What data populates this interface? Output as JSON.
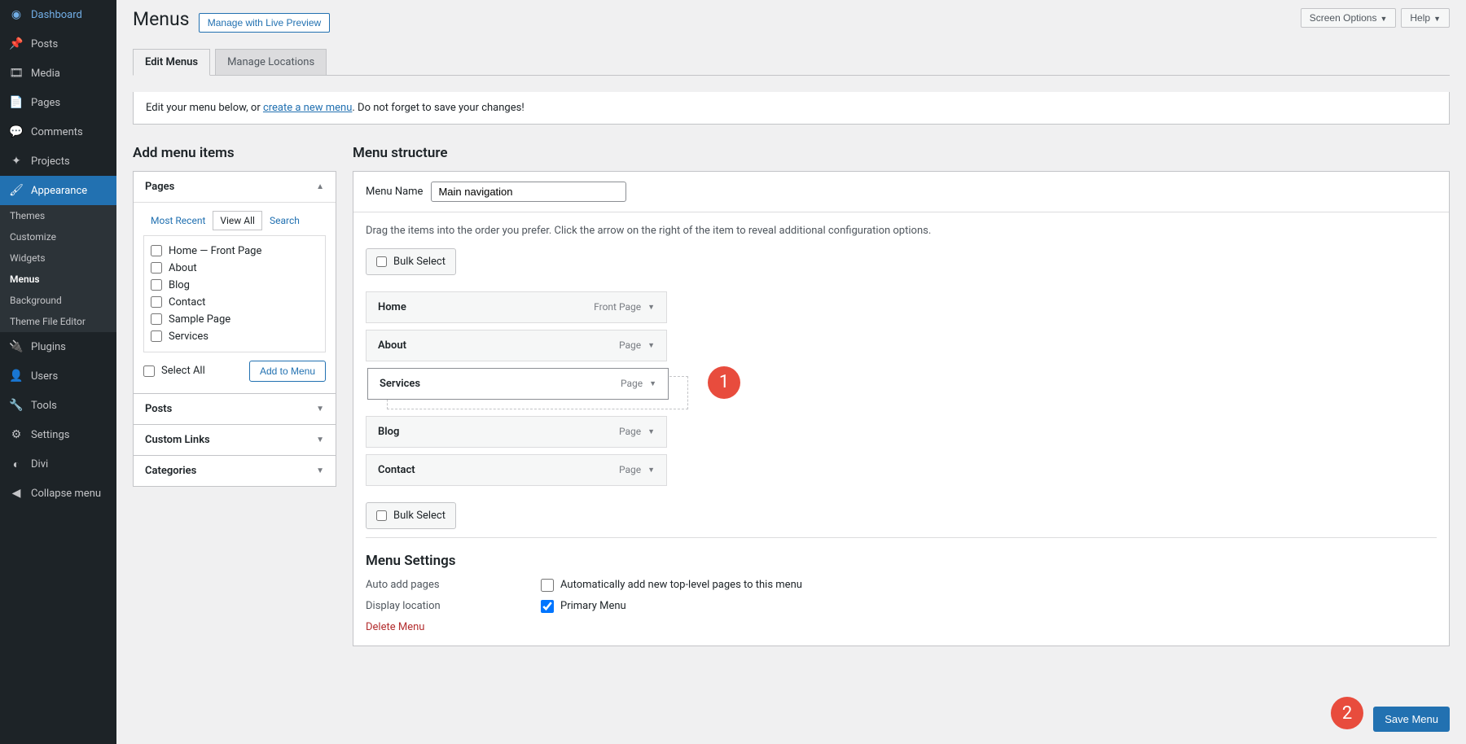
{
  "topbar": {
    "screen_options": "Screen Options",
    "help": "Help"
  },
  "sidebar": {
    "items": [
      {
        "label": "Dashboard"
      },
      {
        "label": "Posts"
      },
      {
        "label": "Media"
      },
      {
        "label": "Pages"
      },
      {
        "label": "Comments"
      },
      {
        "label": "Projects"
      },
      {
        "label": "Appearance"
      },
      {
        "label": "Plugins"
      },
      {
        "label": "Users"
      },
      {
        "label": "Tools"
      },
      {
        "label": "Settings"
      },
      {
        "label": "Divi"
      },
      {
        "label": "Collapse menu"
      }
    ],
    "sub": [
      {
        "label": "Themes"
      },
      {
        "label": "Customize"
      },
      {
        "label": "Widgets"
      },
      {
        "label": "Menus"
      },
      {
        "label": "Background"
      },
      {
        "label": "Theme File Editor"
      }
    ]
  },
  "page": {
    "title": "Menus",
    "live_preview": "Manage with Live Preview",
    "tabs": {
      "edit": "Edit Menus",
      "locations": "Manage Locations"
    },
    "notice_pre": "Edit your menu below, or ",
    "notice_link": "create a new menu",
    "notice_post": ". Do not forget to save your changes!"
  },
  "add": {
    "title": "Add menu items",
    "pages_head": "Pages",
    "subtabs": {
      "recent": "Most Recent",
      "all": "View All",
      "search": "Search"
    },
    "list": [
      "Home — Front Page",
      "About",
      "Blog",
      "Contact",
      "Sample Page",
      "Services"
    ],
    "select_all": "Select All",
    "add_btn": "Add to Menu",
    "posts": "Posts",
    "custom": "Custom Links",
    "categories": "Categories"
  },
  "struct": {
    "title": "Menu structure",
    "name_label": "Menu Name",
    "name_value": "Main navigation",
    "hint": "Drag the items into the order you prefer. Click the arrow on the right of the item to reveal additional configuration options.",
    "bulk": "Bulk Select",
    "items": [
      {
        "label": "Home",
        "type": "Front Page"
      },
      {
        "label": "About",
        "type": "Page"
      },
      {
        "label": "Services",
        "type": "Page"
      },
      {
        "label": "Blog",
        "type": "Page"
      },
      {
        "label": "Contact",
        "type": "Page"
      }
    ]
  },
  "settings": {
    "title": "Menu Settings",
    "auto_label": "Auto add pages",
    "auto_text": "Automatically add new top-level pages to this menu",
    "display_label": "Display location",
    "primary": "Primary Menu",
    "delete": "Delete Menu",
    "save": "Save Menu"
  },
  "annotations": {
    "one": "1",
    "two": "2"
  }
}
